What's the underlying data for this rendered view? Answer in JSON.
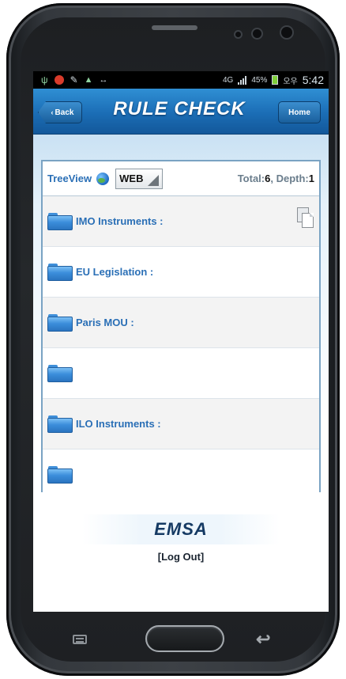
{
  "statusbar": {
    "network_label": "4G",
    "battery_percent": "45%",
    "carrier_label": "오우",
    "time": "5:42"
  },
  "appbar": {
    "back_label": "Back",
    "title": "RULE CHECK",
    "home_label": "Home"
  },
  "tree": {
    "view_label": "TreeView",
    "selected_mode": "WEB",
    "total_label": "Total:",
    "total_value": "6",
    "depth_label": "Depth:",
    "depth_value": "1",
    "rows": [
      {
        "label": "IMO Instruments :",
        "has_copy_icon": true
      },
      {
        "label": "EU Legislation :"
      },
      {
        "label": "Paris MOU :"
      },
      {
        "label": ""
      },
      {
        "label": "ILO Instruments :"
      },
      {
        "label": ""
      }
    ]
  },
  "footer": {
    "brand": "EMSA",
    "logout_label": "[Log Out]"
  },
  "colors": {
    "appbar_blue": "#1b6db5",
    "link_blue": "#2a6fb6",
    "brand_navy": "#153a63"
  },
  "icons": {
    "folder": "folder-icon",
    "copy": "copy-icon",
    "globe": "globe-icon"
  }
}
